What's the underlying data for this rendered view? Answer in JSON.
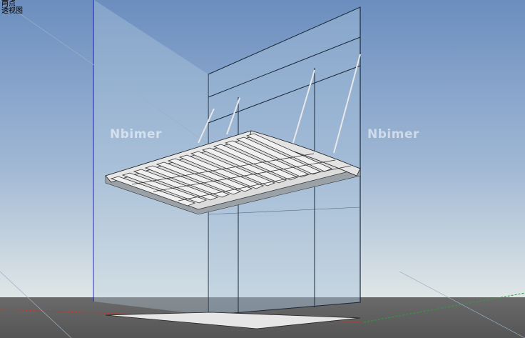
{
  "view": {
    "projection_label": "两点",
    "camera_label": "透视图"
  },
  "watermark": {
    "left_text": "Nbimer",
    "right_text": "Nbimer"
  },
  "colors": {
    "sky_top": "#6d8fc0",
    "sky_bottom": "#d8e1e4",
    "ground": "#5c5c5c",
    "glass": "#a9c4dc",
    "edge": "#1a2a3a",
    "blue_axis": "#2222cc",
    "red_axis": "#cc2222",
    "green_axis": "#22aa22"
  }
}
